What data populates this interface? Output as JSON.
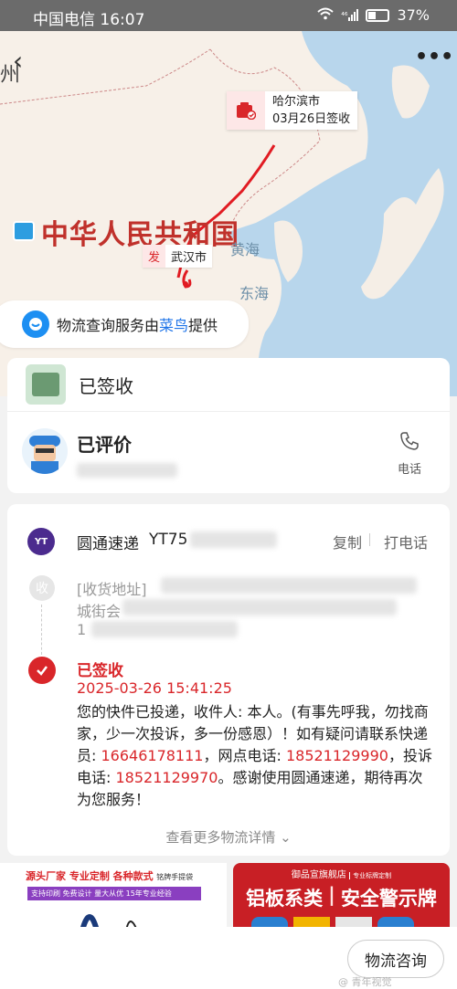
{
  "status": {
    "carrier_time": "中国电信 16:07",
    "signal": "⁴⁶",
    "battery": "37%"
  },
  "map": {
    "country": "中华人民共和国",
    "sea_yellow": "黄海",
    "sea_east": "东海",
    "edge_text": "州",
    "origin_badge": "发",
    "origin_city": "武汉市",
    "dest_city": "哈尔滨市",
    "dest_date": "03月26日签收"
  },
  "provider_banner": {
    "prefix": "物流查询服务由",
    "brand": "菜鸟",
    "suffix": "提供"
  },
  "status_card": {
    "title": "已签收"
  },
  "courier_card": {
    "title": "已评价",
    "call_label": "电话"
  },
  "tracking": {
    "company": "圆通速递",
    "number_prefix": "YT75",
    "copy_label": "复制",
    "call_label": "打电话",
    "address_badge": "收",
    "address_prefix": "[收货地址]",
    "address_line2": "城街会",
    "address_line3": "1",
    "signed_title": "已签收",
    "signed_time": "2025-03-26 15:41:25",
    "msg_a": "您的快件已投递，收件人: 本人。(有事先呼我，勿找商家，少一次投诉，多一份感恩）！如有疑问请联系快递员: ",
    "phone_courier": "16646178111",
    "msg_b": "，网点电话: ",
    "phone_branch": "18521129990",
    "msg_c": "，投诉电话: ",
    "phone_complaint": "18521129970",
    "msg_d": "。感谢使用圆通速递，期待再次为您服务！",
    "more_details": "查看更多物流详情"
  },
  "ads": {
    "left_line1": "源头厂家 专业定制 各种款式",
    "left_small": "铭牌手提袋",
    "left_line2": "支持印刷 免费设计 量大从优 15年专业经验",
    "right_top": "御品宣旗舰店",
    "right_top_small": "专业标牌定制",
    "right_main_a": "铝板系类",
    "right_main_b": "安全警示牌"
  },
  "bottom": {
    "consult_button": "物流咨询",
    "watermark": "@ 青年视觉"
  }
}
